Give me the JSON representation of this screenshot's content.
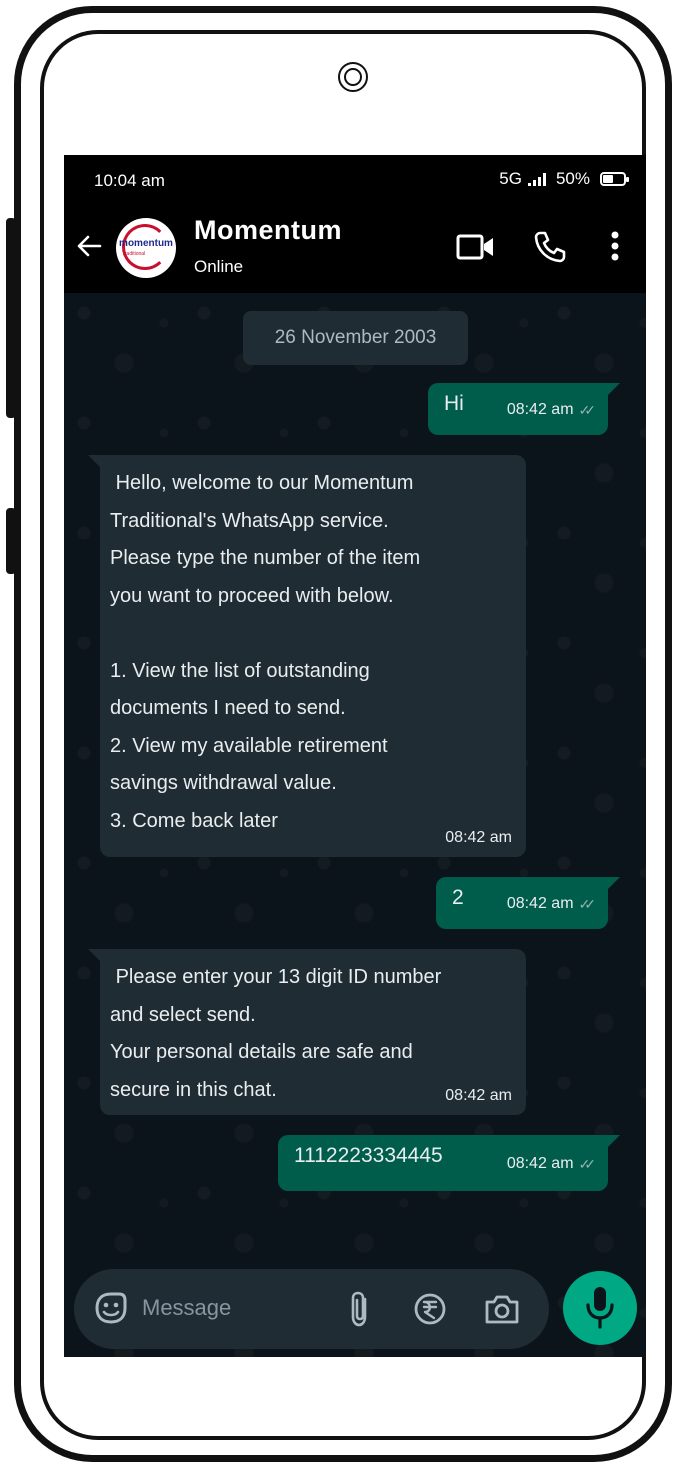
{
  "status_bar": {
    "time": "10:04 am",
    "network": "5G",
    "battery": "50%"
  },
  "header": {
    "contact_name": "Momentum",
    "contact_status": "Online",
    "avatar_text": "momentum",
    "avatar_subtext": "Traditional",
    "icons": [
      "back-arrow-icon",
      "video-call-icon",
      "phone-call-icon",
      "more-options-icon"
    ]
  },
  "chat": {
    "date": "26 November 2003",
    "messages": [
      {
        "direction": "out",
        "text": "Hi",
        "time": "08:42 am",
        "read": true
      },
      {
        "direction": "in",
        "text": " Hello, welcome to our Momentum\nTraditional's WhatsApp service.\nPlease type the number of the item\nyou want to proceed with below.\n\n1. View the list of outstanding\ndocuments I need to send.\n2. View my available retirement\nsavings withdrawal value.\n3. Come back later",
        "time": "08:42 am"
      },
      {
        "direction": "out",
        "text": "2",
        "time": "08:42 am",
        "read": true
      },
      {
        "direction": "in",
        "text": " Please enter your 13 digit ID number\nand select send.\nYour personal details are safe and\nsecure in this chat.",
        "time": "08:42 am"
      },
      {
        "direction": "out",
        "text": "1112223334445",
        "time": "08:42 am",
        "read": true
      }
    ]
  },
  "composer": {
    "placeholder": "Message",
    "icons": [
      "sticker-icon",
      "attach-icon",
      "rupee-payment-icon",
      "camera-icon",
      "mic-icon"
    ]
  },
  "colors": {
    "chat_background": "#0b141a",
    "outgoing_bubble": "#005c4b",
    "incoming_bubble": "#202c33",
    "accent_green": "#00a884"
  }
}
